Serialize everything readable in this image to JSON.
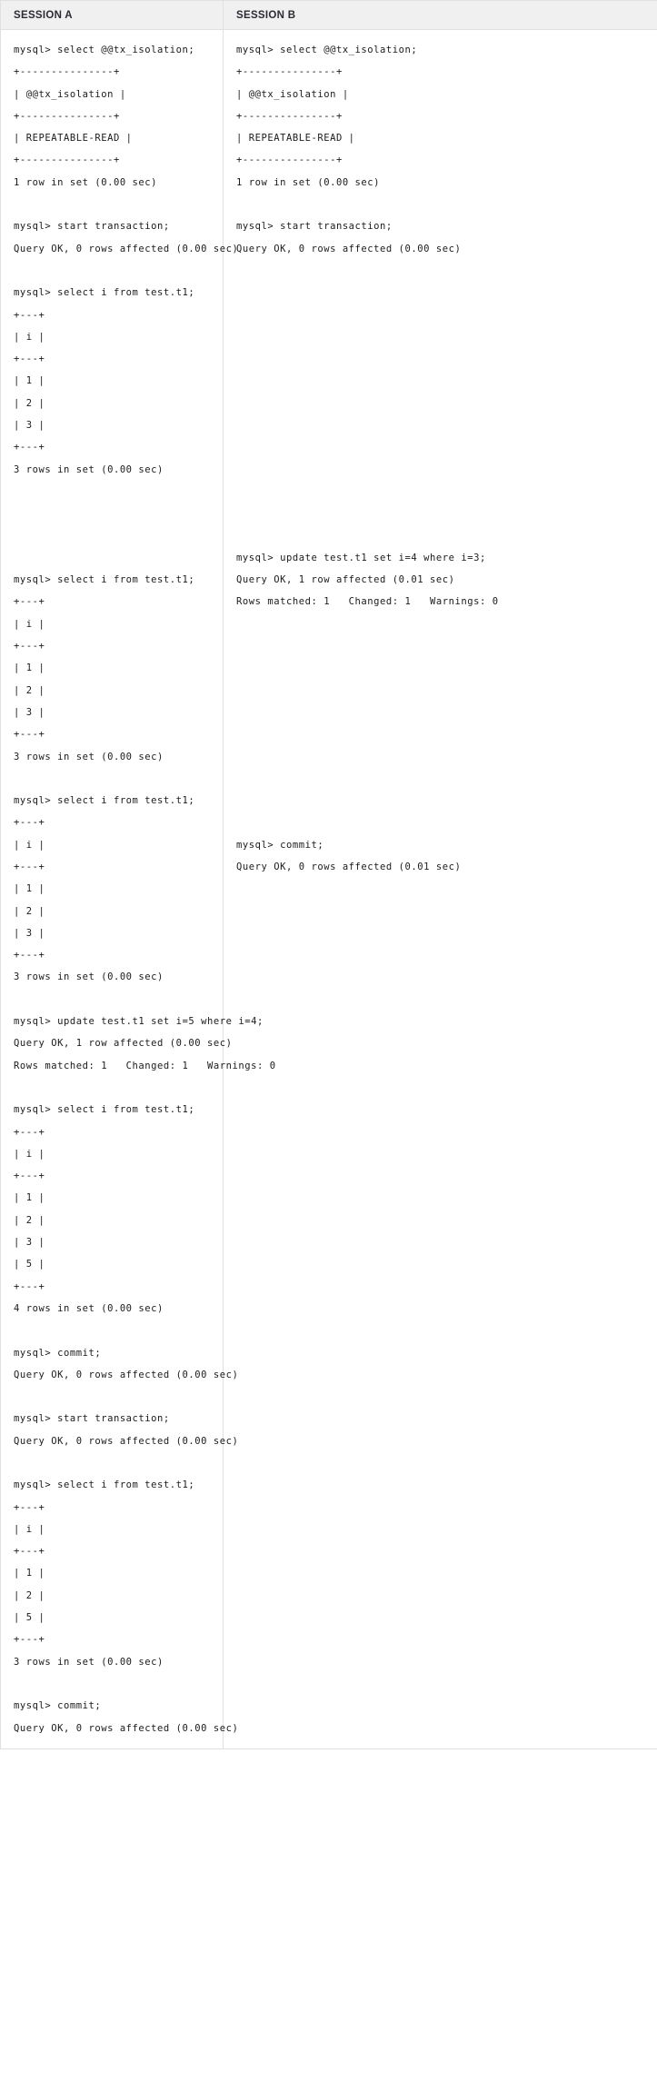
{
  "table": {
    "columns": [
      {
        "id": "session-a",
        "header": "SESSION A"
      },
      {
        "id": "session-b",
        "header": "SESSION B"
      }
    ],
    "header_background": "#f0f0f0",
    "header_text_color": "#2b2b33",
    "border_color": "#e0e0e0",
    "terminal_text_color": "#1b1b1b"
  },
  "session_a": {
    "label": "SESSION A",
    "transcript": "mysql> select @@tx_isolation;\n+---------------+\n| @@tx_isolation |\n+---------------+\n| REPEATABLE-READ |\n+---------------+\n1 row in set (0.00 sec)\n\nmysql> start transaction;\nQuery OK, 0 rows affected (0.00 sec)\n\nmysql> select i from test.t1;\n+---+\n| i |\n+---+\n| 1 |\n| 2 |\n| 3 |\n+---+\n3 rows in set (0.00 sec)\n\n\n\n\nmysql> select i from test.t1;\n+---+\n| i |\n+---+\n| 1 |\n| 2 |\n| 3 |\n+---+\n3 rows in set (0.00 sec)\n\nmysql> select i from test.t1;\n+---+\n| i |\n+---+\n| 1 |\n| 2 |\n| 3 |\n+---+\n3 rows in set (0.00 sec)\n\nmysql> update test.t1 set i=5 where i=4;\nQuery OK, 1 row affected (0.00 sec)\nRows matched: 1   Changed: 1   Warnings: 0\n\nmysql> select i from test.t1;\n+---+\n| i |\n+---+\n| 1 |\n| 2 |\n| 3 |\n| 5 |\n+---+\n4 rows in set (0.00 sec)\n\nmysql> commit;\nQuery OK, 0 rows affected (0.00 sec)\n\nmysql> start transaction;\nQuery OK, 0 rows affected (0.00 sec)\n\nmysql> select i from test.t1;\n+---+\n| i |\n+---+\n| 1 |\n| 2 |\n| 5 |\n+---+\n3 rows in set (0.00 sec)\n\nmysql> commit;\nQuery OK, 0 rows affected (0.00 sec)"
  },
  "session_b": {
    "label": "SESSION B",
    "transcript": "mysql> select @@tx_isolation;\n+---------------+\n| @@tx_isolation |\n+---------------+\n| REPEATABLE-READ |\n+---------------+\n1 row in set (0.00 sec)\n\nmysql> start transaction;\nQuery OK, 0 rows affected (0.00 sec)\n\n\n\n\n\n\n\n\n\n\n\n\n\nmysql> update test.t1 set i=4 where i=3;\nQuery OK, 1 row affected (0.01 sec)\nRows matched: 1   Changed: 1   Warnings: 0\n\n\n\n\n\n\n\n\n\n\nmysql> commit;\nQuery OK, 0 rows affected (0.01 sec)"
  }
}
